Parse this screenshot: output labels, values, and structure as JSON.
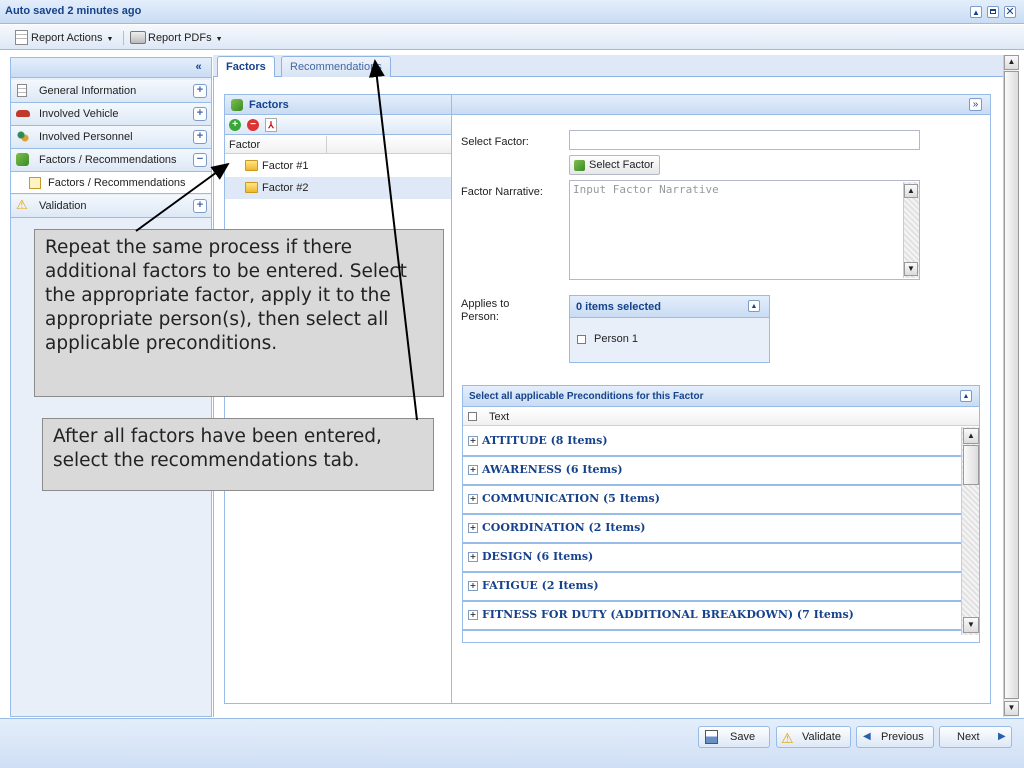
{
  "window": {
    "title": "Auto saved 2 minutes ago"
  },
  "toolbar": {
    "report_actions": "Report Actions",
    "report_pdfs": "Report PDFs"
  },
  "sidebar": {
    "items": [
      {
        "label": "General Information"
      },
      {
        "label": "Involved Vehicle"
      },
      {
        "label": "Involved Personnel"
      },
      {
        "label": "Factors / Recommendations"
      }
    ],
    "subitem": {
      "label": "Factors / Recommendations"
    },
    "validation": {
      "label": "Validation"
    }
  },
  "tabs": [
    {
      "label": "Factors"
    },
    {
      "label": "Recommendations"
    }
  ],
  "factors_panel": {
    "title": "Factors",
    "column": "Factor",
    "items": [
      {
        "label": "Factor #1"
      },
      {
        "label": "Factor #2"
      }
    ]
  },
  "form": {
    "select_factor_label": "Select Factor:",
    "select_factor_value": "",
    "select_factor_button": "Select Factor",
    "narrative_label": "Factor Narrative:",
    "narrative_placeholder": "Input Factor Narrative",
    "applies_label": "Applies to Person:",
    "applies_header": "0 items selected",
    "person": "Person 1"
  },
  "preconditions": {
    "title": "Select all applicable Preconditions for this Factor",
    "column": "Text",
    "categories": [
      {
        "label": "ATTITUDE (8 Items)"
      },
      {
        "label": "AWARENESS (6 Items)"
      },
      {
        "label": "COMMUNICATION (5 Items)"
      },
      {
        "label": "COORDINATION (2 Items)"
      },
      {
        "label": "DESIGN (6 Items)"
      },
      {
        "label": "FATIGUE (2 Items)"
      },
      {
        "label": "FITNESS FOR DUTY (ADDITIONAL BREAKDOWN) (7 Items)"
      }
    ]
  },
  "buttons": {
    "save": "Save",
    "validate": "Validate",
    "previous": "Previous",
    "next": "Next"
  },
  "callouts": {
    "repeat": "Repeat the same process if there additional factors to be entered. Select the appropriate factor, apply it to the appropriate person(s), then select all applicable preconditions.",
    "after": "After all factors have been entered, select the recommendations tab."
  },
  "colors": {
    "header_text": "#15428b",
    "border": "#99bbe8",
    "callout_bg": "#d9d9d9"
  }
}
